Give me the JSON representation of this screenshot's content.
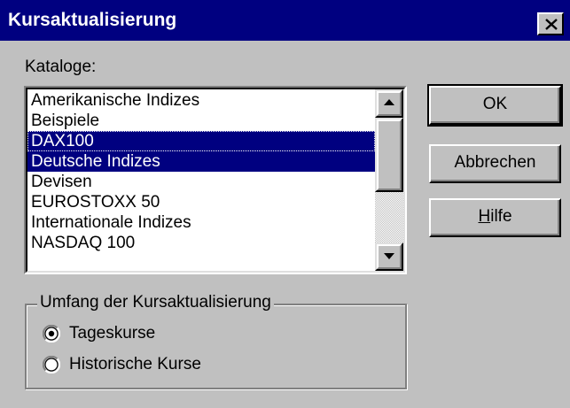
{
  "window": {
    "title": "Kursaktualisierung"
  },
  "catalogs": {
    "label": "Kataloge:",
    "items": [
      {
        "label": "Amerikanische Indizes",
        "selected": false
      },
      {
        "label": "Beispiele",
        "selected": false
      },
      {
        "label": "DAX100",
        "selected": true
      },
      {
        "label": "Deutsche Indizes",
        "selected": true
      },
      {
        "label": "Devisen",
        "selected": false
      },
      {
        "label": "EUROSTOXX 50",
        "selected": false
      },
      {
        "label": "Internationale Indizes",
        "selected": false
      },
      {
        "label": "NASDAQ 100",
        "selected": false
      }
    ]
  },
  "buttons": {
    "ok": "OK",
    "cancel": "Abbrechen",
    "help_mnemonic": "H",
    "help_rest": "ilfe"
  },
  "scope": {
    "title": "Umfang der Kursaktualisierung",
    "options": [
      {
        "label": "Tageskurse",
        "checked": true
      },
      {
        "label": "Historische Kurse",
        "checked": false
      }
    ]
  },
  "colors": {
    "titlebar": "#000080",
    "selection": "#000080",
    "face": "#c0c0c0"
  }
}
